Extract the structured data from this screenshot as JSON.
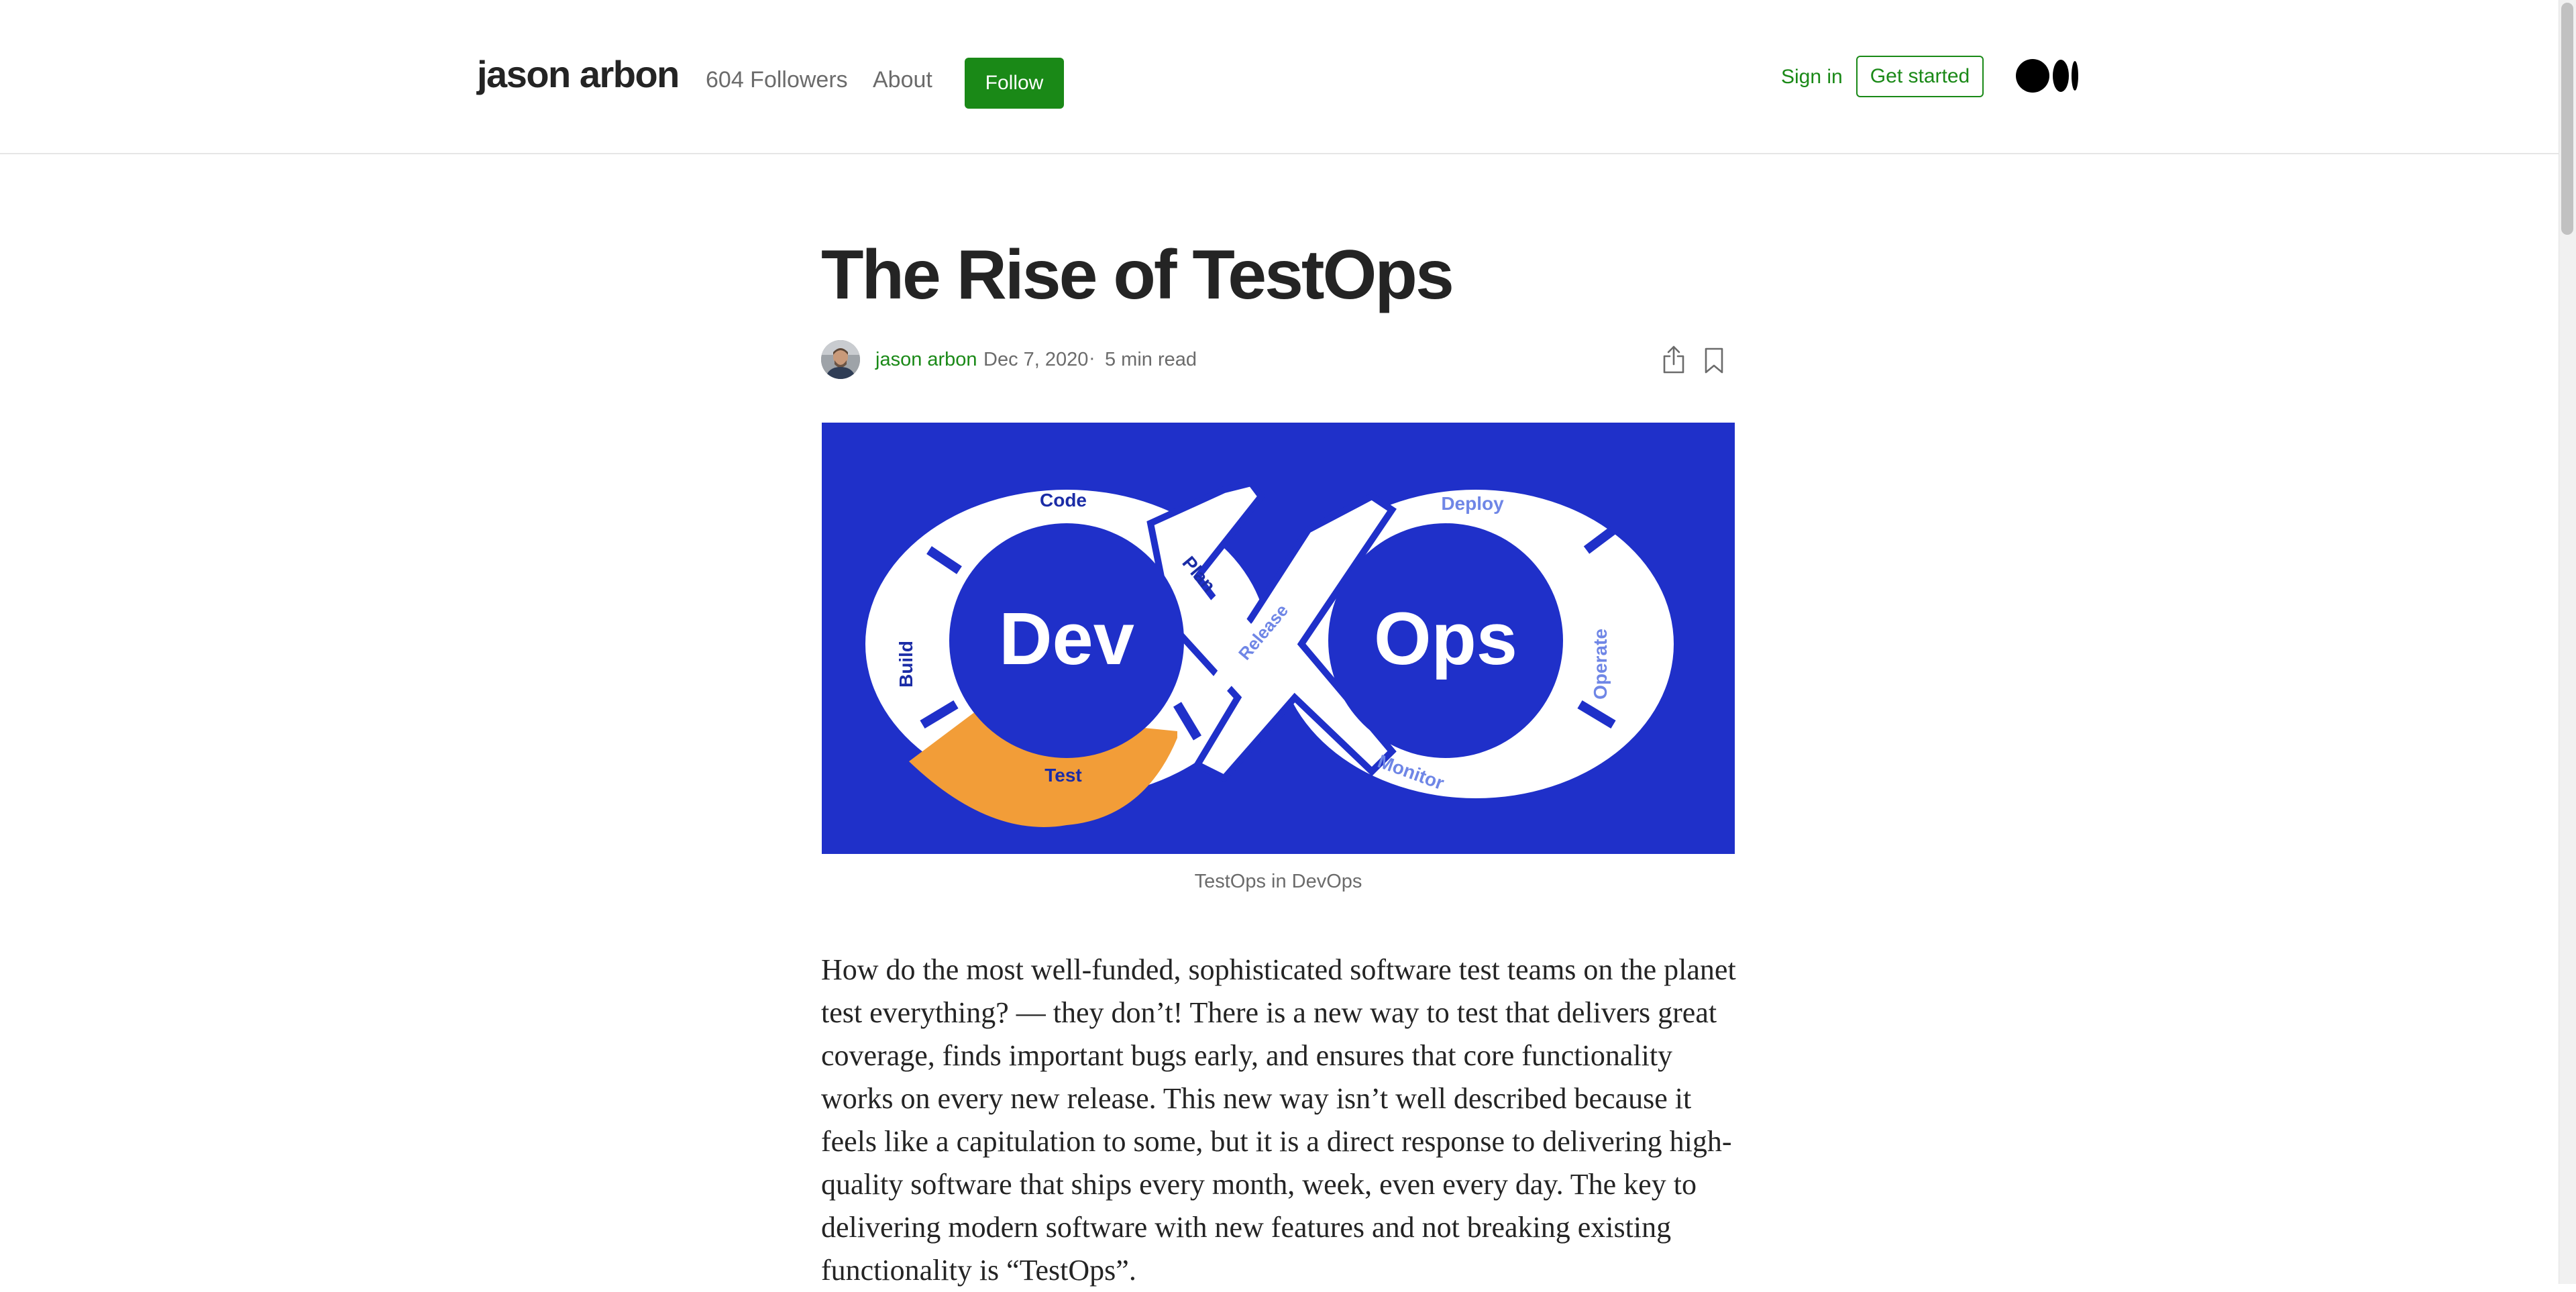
{
  "header": {
    "publication_name": "jason arbon",
    "followers": "604 Followers",
    "about": "About",
    "follow_label": "Follow",
    "sign_in": "Sign in",
    "get_started": "Get started",
    "logo_icon": "medium-logo-icon"
  },
  "article": {
    "title": "The Rise of TestOps",
    "author": "jason arbon",
    "date": "Dec 7, 2020",
    "separator": "·",
    "read_time": "5 min read",
    "share_icon": "share-icon",
    "bookmark_icon": "bookmark-icon",
    "image": {
      "dev_label": "Dev",
      "ops_label": "Ops",
      "stages": {
        "plan": "Plan",
        "code": "Code",
        "build": "Build",
        "test": "Test",
        "release": "Release",
        "deploy": "Deploy",
        "operate": "Operate",
        "monitor": "Monitor"
      },
      "colors": {
        "background": "#1f30c9",
        "loop": "#ffffff",
        "highlight": "#f29d38",
        "dev_text": "#1b2ca6",
        "ops_text": "#6f86e6"
      }
    },
    "caption": "TestOps in DevOps",
    "body": "How do the most well-funded, sophisticated software test teams on the planet test everything? — they don’t! There is a new way to test that delivers great coverage, finds important bugs early, and ensures that core functionality works on every new release. This new way isn’t well described because it feels like a capitulation to some, but it is a direct response to delivering high-quality software that ships every month, week, even every day. The key to delivering modern software with new features and not breaking existing functionality is “TestOps”."
  }
}
